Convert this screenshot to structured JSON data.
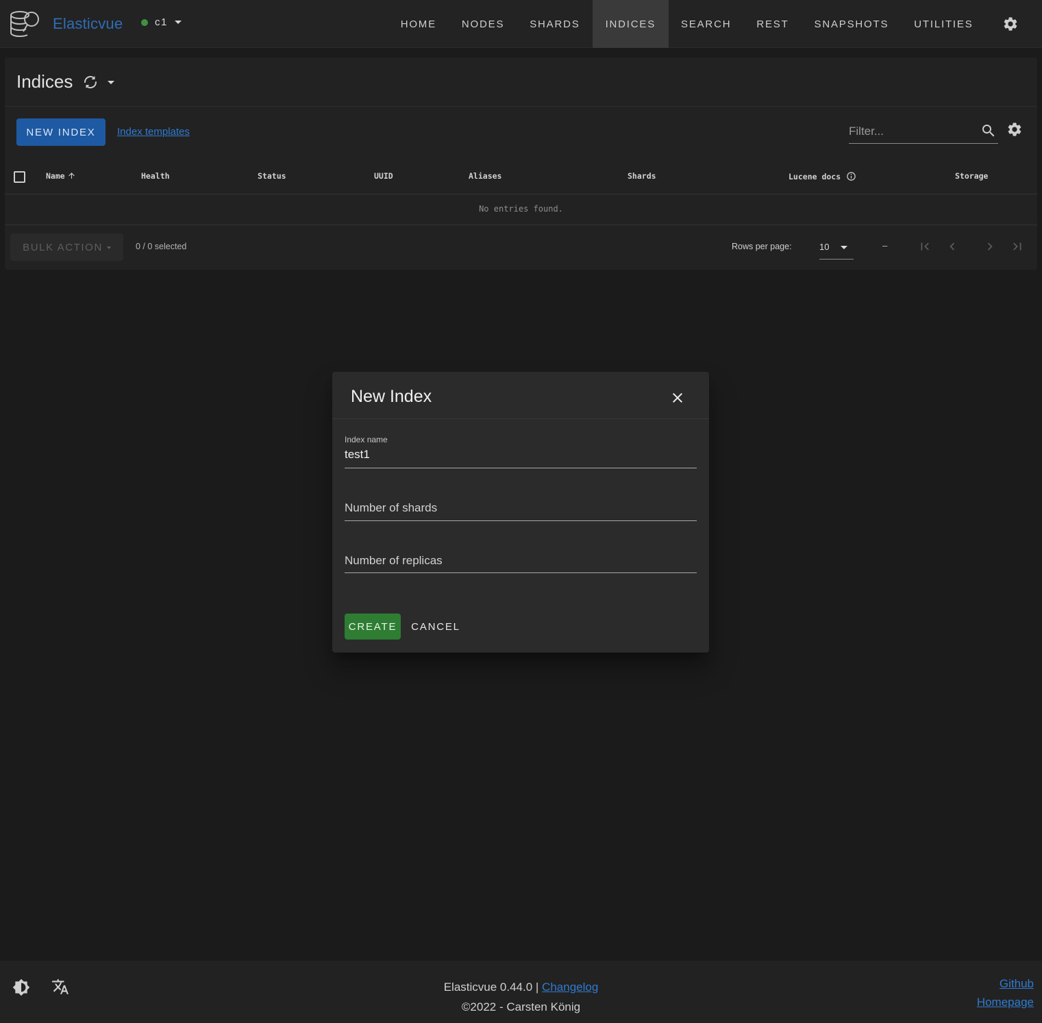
{
  "app": {
    "brand": "Elasticvue",
    "cluster_name": "c1",
    "cluster_status_color": "#3f9142"
  },
  "nav": {
    "items": [
      {
        "label": "HOME",
        "active": false
      },
      {
        "label": "NODES",
        "active": false
      },
      {
        "label": "SHARDS",
        "active": false
      },
      {
        "label": "INDICES",
        "active": true
      },
      {
        "label": "SEARCH",
        "active": false
      },
      {
        "label": "REST",
        "active": false
      },
      {
        "label": "SNAPSHOTS",
        "active": false
      },
      {
        "label": "UTILITIES",
        "active": false
      }
    ],
    "settings_icon": "gear-icon"
  },
  "indices": {
    "title": "Indices",
    "new_index_label": "NEW INDEX",
    "templates_link": "Index templates",
    "filter_placeholder": "Filter...",
    "columns": {
      "name": "Name",
      "health": "Health",
      "status": "Status",
      "uuid": "UUID",
      "aliases": "Aliases",
      "shards": "Shards",
      "lucene_docs": "Lucene docs",
      "storage": "Storage"
    },
    "empty_text": "No entries found.",
    "bulk_action_label": "BULK ACTION",
    "selected_text": "0 / 0 selected",
    "rows_per_page_label": "Rows per page:",
    "rows_per_page_value": "10",
    "page_range": "–"
  },
  "dialog": {
    "title": "New Index",
    "index_name_label": "Index name",
    "index_name_value": "test1",
    "shards_placeholder": "Number of shards",
    "replicas_placeholder": "Number of replicas",
    "create_label": "CREATE",
    "cancel_label": "CANCEL"
  },
  "footer": {
    "version_text": "Elasticvue 0.44.0 |",
    "changelog_link": "Changelog",
    "copyright": "©2022 - Carsten König",
    "github_link": "Github",
    "homepage_link": "Homepage"
  },
  "colors": {
    "brand": "#2f6db5",
    "primary_button": "#1e5aa3",
    "create_button": "#2e7d32",
    "link": "#2f7bd0",
    "background": "#1b1b1b"
  }
}
